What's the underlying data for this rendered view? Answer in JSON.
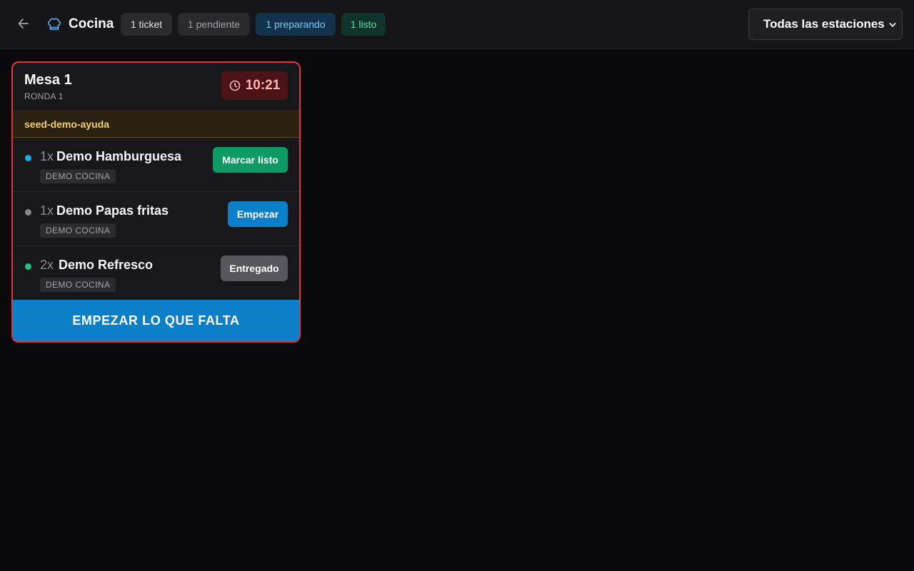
{
  "header": {
    "title": "Cocina",
    "badges": {
      "tickets": "1 ticket",
      "pending": "1 pendiente",
      "preparing": "1 preparando",
      "ready": "1 listo"
    },
    "station_filter": {
      "selected": "Todas las estaciones"
    }
  },
  "ticket": {
    "table": "Mesa 1",
    "round": "RONDA 1",
    "timer": "10:21",
    "note": "seed-demo-ayuda",
    "items": [
      {
        "qty": "1x",
        "name": "Demo Hamburguesa",
        "station": "DEMO COCINA",
        "status": "preparing",
        "action": "Marcar listo"
      },
      {
        "qty": "1x",
        "name": "Demo Papas fritas",
        "station": "DEMO COCINA",
        "status": "pending",
        "action": "Empezar"
      },
      {
        "qty": "2x",
        "name": "Demo Refresco",
        "station": "DEMO COCINA",
        "status": "ready",
        "action": "Entregado"
      }
    ],
    "cta": "EMPEZAR LO QUE FALTA"
  },
  "colors": {
    "preparing": "#1ba9ef",
    "pending": "#8a8a8e",
    "ready": "#22c37d",
    "urgent_border": "#e5363d",
    "primary": "#0b7fc8",
    "success": "#0d9a64"
  },
  "icons": {
    "back": "arrow-left-icon",
    "kitchen": "chef-hat-icon",
    "timer": "clock-icon",
    "select": "chevron-down-icon"
  }
}
